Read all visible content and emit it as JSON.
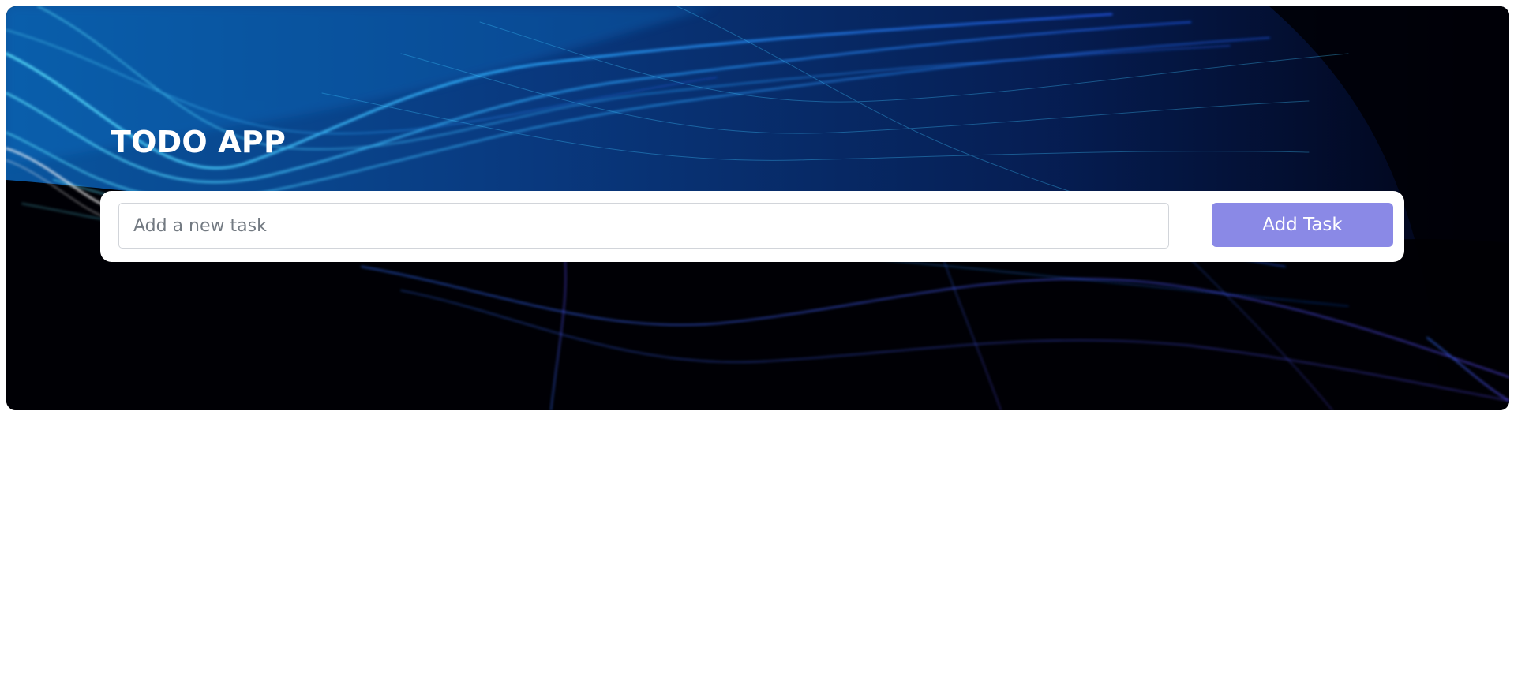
{
  "app": {
    "title": "TODO APP"
  },
  "task_form": {
    "input_value": "",
    "input_placeholder": "Add a new task",
    "add_button_label": "Add Task"
  },
  "colors": {
    "add_button": "#8a89e6",
    "hero_background": "#000005",
    "title_text": "#ffffff"
  }
}
